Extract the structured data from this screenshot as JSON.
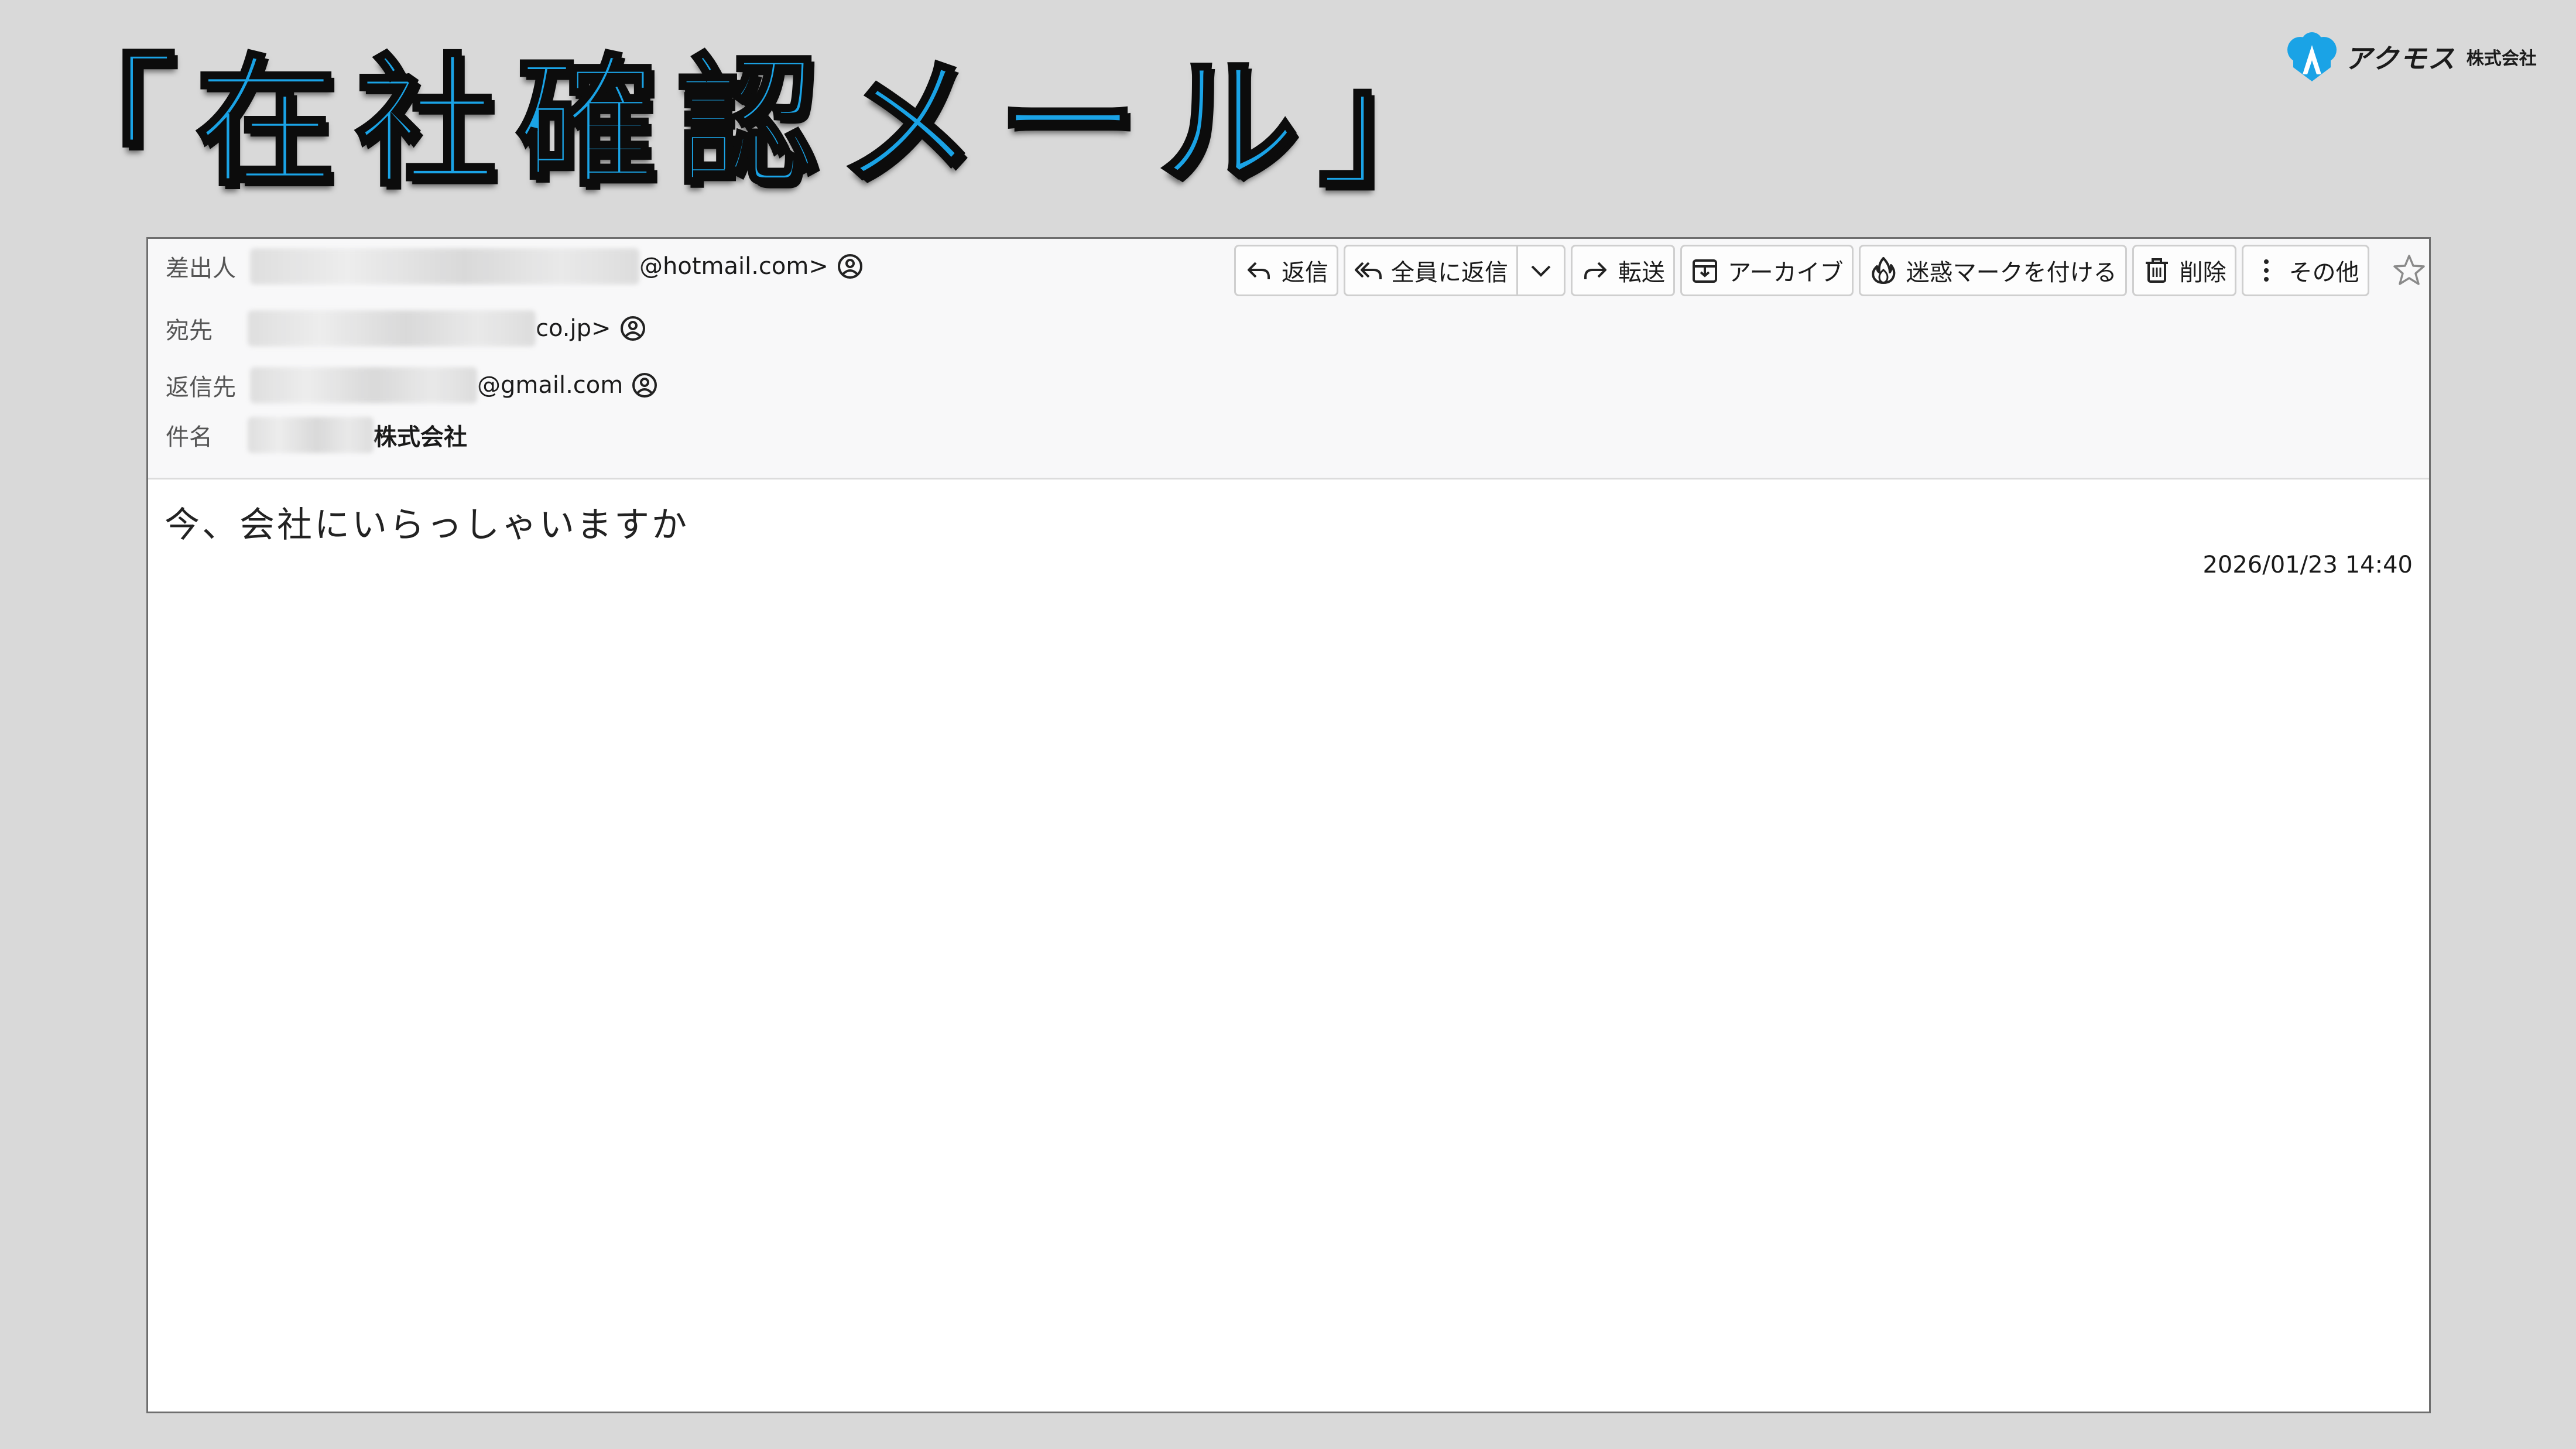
{
  "slide": {
    "title": "「在社確認メール」"
  },
  "logo": {
    "name": "アクモス",
    "suffix": "株式会社",
    "brand_color": "#1aa3e6"
  },
  "email": {
    "from_label": "差出人",
    "from_value_suffix": "@hotmail.com>",
    "to_label": "宛先",
    "to_value_suffix": "co.jp>",
    "reply_to_label": "返信先",
    "reply_to_value_suffix": "@gmail.com",
    "subject_label": "件名",
    "subject_value_suffix": "株式会社",
    "date": "2026/01/23 14:40",
    "body": "今、会社にいらっしゃいますか"
  },
  "toolbar": {
    "reply": "返信",
    "reply_all": "全員に返信",
    "forward": "転送",
    "archive": "アーカイブ",
    "junk": "迷惑マークを付ける",
    "delete": "削除",
    "more": "その他"
  },
  "icons": {
    "reply": "reply-icon",
    "reply_all": "reply-all-icon",
    "forward": "forward-icon",
    "archive": "archive-icon",
    "junk": "flame-icon",
    "delete": "trash-icon",
    "more": "vertical-dots-icon",
    "star": "star-icon",
    "contact": "contact-icon"
  }
}
